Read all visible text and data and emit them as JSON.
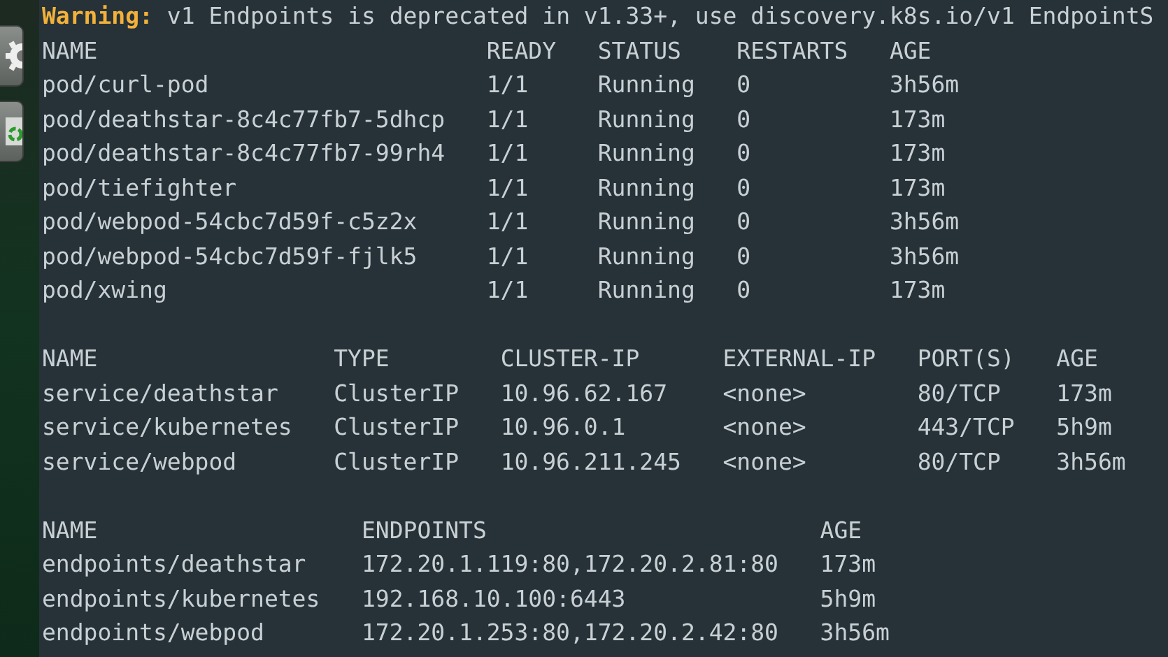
{
  "warning": {
    "label": "Warning:",
    "message": "v1 Endpoints is deprecated in v1.33+, use discovery.k8s.io/v1 EndpointS"
  },
  "tables": [
    {
      "columns": [
        "NAME",
        "READY",
        "STATUS",
        "RESTARTS",
        "AGE"
      ],
      "rows": [
        [
          "pod/curl-pod",
          "1/1",
          "Running",
          "0",
          "3h56m"
        ],
        [
          "pod/deathstar-8c4c77fb7-5dhcp",
          "1/1",
          "Running",
          "0",
          "173m"
        ],
        [
          "pod/deathstar-8c4c77fb7-99rh4",
          "1/1",
          "Running",
          "0",
          "173m"
        ],
        [
          "pod/tiefighter",
          "1/1",
          "Running",
          "0",
          "173m"
        ],
        [
          "pod/webpod-54cbc7d59f-c5z2x",
          "1/1",
          "Running",
          "0",
          "3h56m"
        ],
        [
          "pod/webpod-54cbc7d59f-fjlk5",
          "1/1",
          "Running",
          "0",
          "3h56m"
        ],
        [
          "pod/xwing",
          "1/1",
          "Running",
          "0",
          "173m"
        ]
      ]
    },
    {
      "columns": [
        "NAME",
        "TYPE",
        "CLUSTER-IP",
        "EXTERNAL-IP",
        "PORT(S)",
        "AGE"
      ],
      "rows": [
        [
          "service/deathstar",
          "ClusterIP",
          "10.96.62.167",
          "<none>",
          "80/TCP",
          "173m"
        ],
        [
          "service/kubernetes",
          "ClusterIP",
          "10.96.0.1",
          "<none>",
          "443/TCP",
          "5h9m"
        ],
        [
          "service/webpod",
          "ClusterIP",
          "10.96.211.245",
          "<none>",
          "80/TCP",
          "3h56m"
        ]
      ]
    },
    {
      "columns": [
        "NAME",
        "ENDPOINTS",
        "AGE"
      ],
      "rows": [
        [
          "endpoints/deathstar",
          "172.20.1.119:80,172.20.2.81:80",
          "173m"
        ],
        [
          "endpoints/kubernetes",
          "192.168.10.100:6443",
          "5h9m"
        ],
        [
          "endpoints/webpod",
          "172.20.1.253:80,172.20.2.42:80",
          "3h56m"
        ]
      ]
    }
  ]
}
